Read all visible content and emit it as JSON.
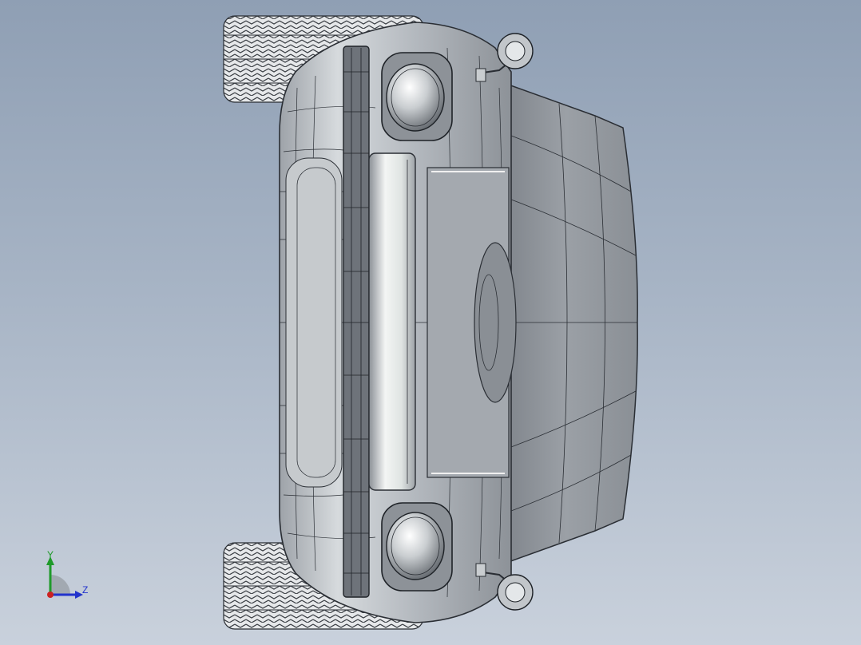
{
  "viewport": {
    "background_top": "#8f9fb4",
    "background_bottom": "#c9d1dc"
  },
  "model": {
    "body_color": "#b9bec4",
    "edge_color": "#2a2e34",
    "shade_color": "#8c9197"
  },
  "triad": {
    "y_label": "Y",
    "z_label": "Z",
    "y_color": "#1f9a2a",
    "z_color": "#2233cc",
    "origin_color": "#cc2222"
  }
}
